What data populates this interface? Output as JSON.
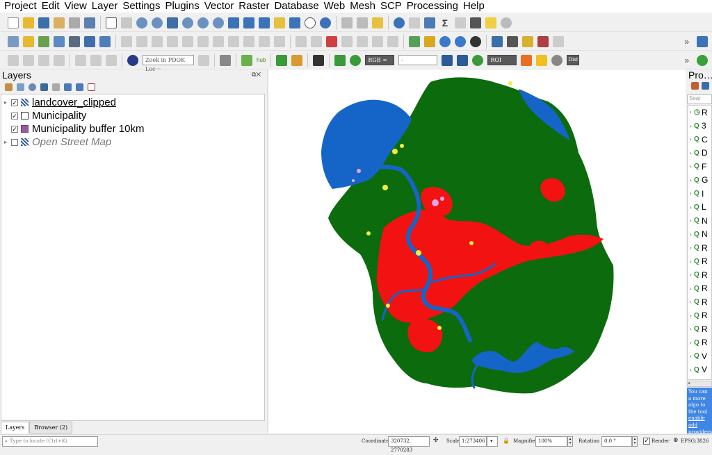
{
  "menubar": {
    "items": [
      "Project",
      "Edit",
      "View",
      "Layer",
      "Settings",
      "Plugins",
      "Vector",
      "Raster",
      "Database",
      "Web",
      "Mesh",
      "SCP",
      "Processing",
      "Help"
    ]
  },
  "toolbar": {
    "pdok_search": "Zoek in PDOK Loc···",
    "hub_label": "hub",
    "rgb_label": "RGB =",
    "rgb_value": "-",
    "roi_label": "ROI",
    "dist_label": "Dist",
    "overflow": "»"
  },
  "layers_panel": {
    "title": "Layers",
    "layers": [
      {
        "name": "landcover_clipped",
        "checked": true,
        "symbol": "raster",
        "expanded": false,
        "active": true
      },
      {
        "name": "Municipality",
        "checked": true,
        "symbol": "polygon-empty"
      },
      {
        "name": "Municipality buffer 10km",
        "checked": true,
        "symbol": "polygon-purple",
        "color": "#9a5aa0"
      },
      {
        "name": "Open Street Map",
        "checked": false,
        "symbol": "raster"
      }
    ],
    "tabs": [
      "Layers",
      "Browser (2)"
    ]
  },
  "processing_panel": {
    "title": "Pro…",
    "search_placeholder": "Sear",
    "items": [
      "R",
      "3",
      "C",
      "D",
      "F",
      "G",
      "I",
      "L",
      "N",
      "N",
      "R",
      "R",
      "R",
      "R",
      "R",
      "R",
      "R",
      "R",
      "V",
      "V"
    ],
    "info_text": "You can a more algo to the tool",
    "info_link": "enable add providers."
  },
  "map": {
    "colors": {
      "water": "#1565c8",
      "forest": "#0c6b0c",
      "urban": "#f21212",
      "agri": "#f0ee40",
      "bare": "#e7a7e7"
    }
  },
  "statusbar": {
    "locate_placeholder": "Type to locate (Ctrl+K)",
    "coordinate_label": "Coordinate",
    "coordinate_value": "320732, 2770283",
    "scale_label": "Scale",
    "scale_value": "1:273406",
    "magnifier_label": "Magnifier",
    "magnifier_value": "100%",
    "rotation_label": "Rotation",
    "rotation_value": "0.0 °",
    "render_label": "Render",
    "crs_label": "EPSG:3826"
  }
}
